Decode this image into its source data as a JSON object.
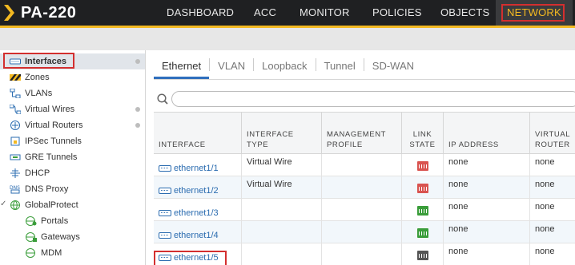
{
  "app": {
    "title": "PA-220",
    "brand_color": "#f3b921",
    "header_bg": "#1f2022"
  },
  "nav": {
    "items": [
      {
        "label": "DASHBOARD",
        "active": false
      },
      {
        "label": "ACC",
        "active": false
      },
      {
        "label": "MONITOR",
        "active": false
      },
      {
        "label": "POLICIES",
        "active": false
      },
      {
        "label": "OBJECTS",
        "active": false
      },
      {
        "label": "NETWORK",
        "active": true
      }
    ]
  },
  "sidebar": {
    "items": [
      {
        "label": "Interfaces",
        "icon": "interface-icon",
        "selected": true,
        "has_dot": true
      },
      {
        "label": "Zones",
        "icon": "zones-icon",
        "selected": false,
        "has_dot": false
      },
      {
        "label": "VLANs",
        "icon": "vlans-icon",
        "selected": false,
        "has_dot": false
      },
      {
        "label": "Virtual Wires",
        "icon": "virtual-wires-icon",
        "selected": false,
        "has_dot": true
      },
      {
        "label": "Virtual Routers",
        "icon": "virtual-routers-icon",
        "selected": false,
        "has_dot": true
      },
      {
        "label": "IPSec Tunnels",
        "icon": "ipsec-tunnels-icon",
        "selected": false,
        "has_dot": false
      },
      {
        "label": "GRE Tunnels",
        "icon": "gre-tunnels-icon",
        "selected": false,
        "has_dot": false
      },
      {
        "label": "DHCP",
        "icon": "dhcp-icon",
        "selected": false,
        "has_dot": false
      },
      {
        "label": "DNS Proxy",
        "icon": "dns-proxy-icon",
        "selected": false,
        "has_dot": false
      },
      {
        "label": "GlobalProtect",
        "icon": "globalprotect-icon",
        "selected": false,
        "has_dot": false,
        "expanded": true
      },
      {
        "label": "Portals",
        "icon": "globalprotect-portals-icon",
        "selected": false,
        "has_dot": false,
        "child": true
      },
      {
        "label": "Gateways",
        "icon": "globalprotect-gateways-icon",
        "selected": false,
        "has_dot": false,
        "child": true
      },
      {
        "label": "MDM",
        "icon": "mdm-icon",
        "selected": false,
        "has_dot": false,
        "child": true
      }
    ]
  },
  "tabs": [
    {
      "label": "Ethernet",
      "active": true
    },
    {
      "label": "VLAN",
      "active": false
    },
    {
      "label": "Loopback",
      "active": false
    },
    {
      "label": "Tunnel",
      "active": false
    },
    {
      "label": "SD-WAN",
      "active": false
    }
  ],
  "search": {
    "value": "",
    "placeholder": ""
  },
  "table": {
    "columns": [
      {
        "label": "INTERFACE"
      },
      {
        "label": "INTERFACE TYPE"
      },
      {
        "label": "MANAGEMENT PROFILE"
      },
      {
        "label": "LINK STATE"
      },
      {
        "label": "IP ADDRESS"
      },
      {
        "label": "VIRTUAL ROUTER"
      }
    ],
    "rows": [
      {
        "interface": "ethernet1/1",
        "type": "Virtual Wire",
        "profile": "",
        "link_state": "down",
        "ip": "none",
        "router": "none"
      },
      {
        "interface": "ethernet1/2",
        "type": "Virtual Wire",
        "profile": "",
        "link_state": "down",
        "ip": "none",
        "router": "none"
      },
      {
        "interface": "ethernet1/3",
        "type": "",
        "profile": "",
        "link_state": "up",
        "ip": "none",
        "router": "none"
      },
      {
        "interface": "ethernet1/4",
        "type": "",
        "profile": "",
        "link_state": "up",
        "ip": "none",
        "router": "none"
      },
      {
        "interface": "ethernet1/5",
        "type": "",
        "profile": "",
        "link_state": "unknown",
        "ip": "none",
        "router": "none"
      }
    ]
  },
  "colors": {
    "link_down": "#d9534f",
    "link_up": "#3a9d3a",
    "link_unknown": "#555555",
    "highlight": "#d32f2f",
    "link_text": "#2b6cb0"
  }
}
